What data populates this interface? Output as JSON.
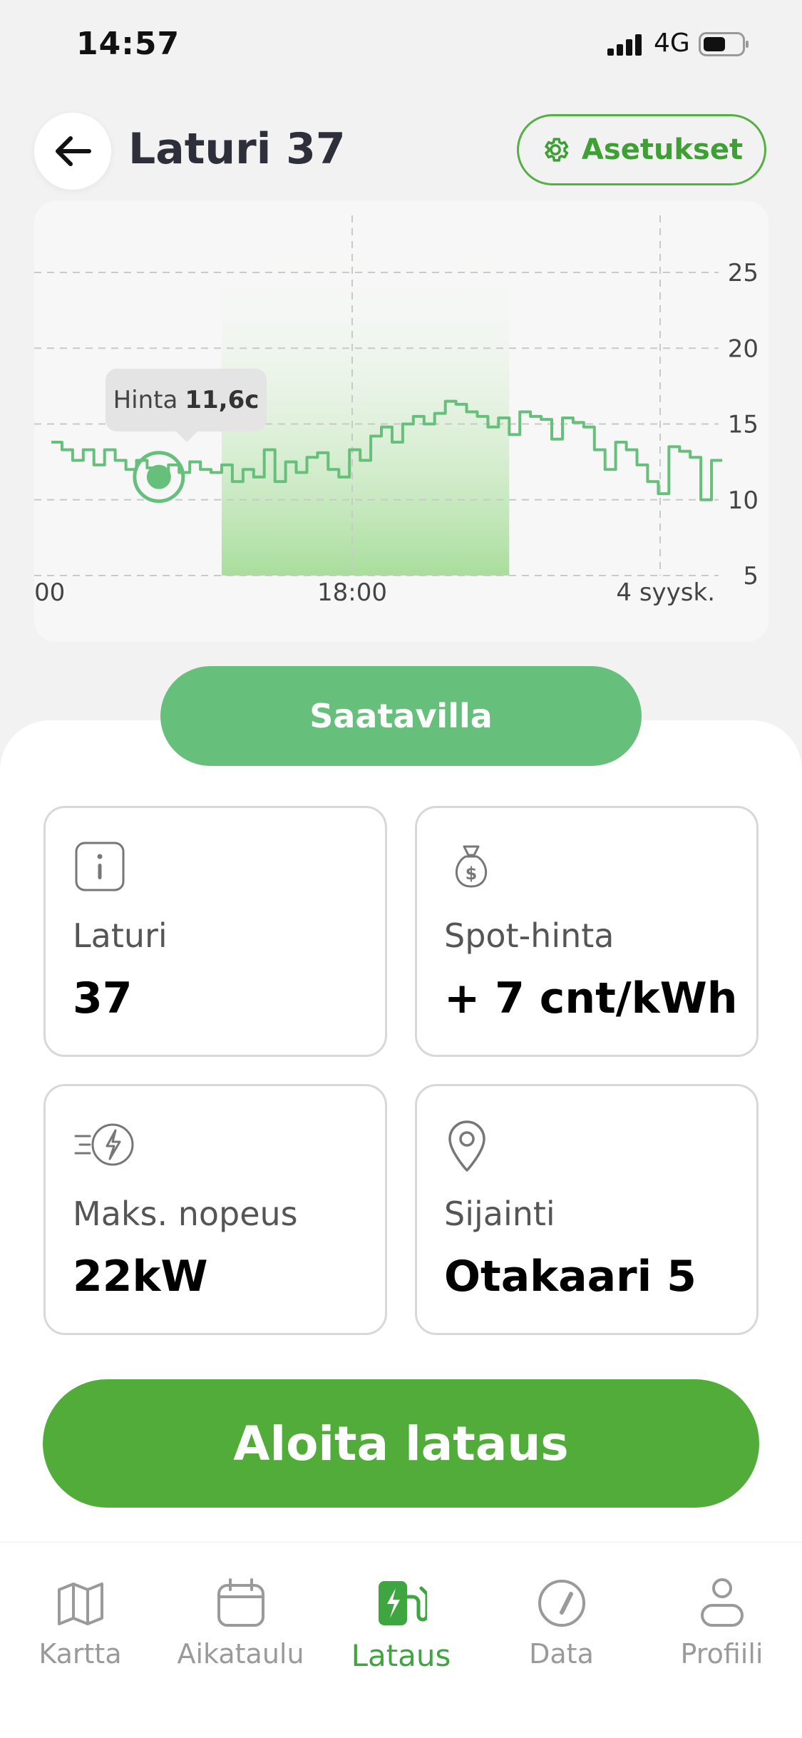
{
  "status_bar": {
    "time": "14:57",
    "network": "4G"
  },
  "header": {
    "title": "Laturi 37",
    "settings_label": "Asetukset"
  },
  "chart_data": {
    "type": "line",
    "x_tick_labels": [
      "00",
      "18:00",
      "4 syysk."
    ],
    "y_ticks": [
      25,
      20,
      15,
      10,
      5
    ],
    "ylim": [
      5,
      27
    ],
    "grid": true,
    "series": [
      {
        "values": [
          13.8,
          13.3,
          12.6,
          13.3,
          12.3,
          13.3,
          12.6,
          12.0,
          12.6,
          12.1,
          11.6,
          12.3,
          11.8,
          12.5,
          12.0,
          11.8,
          12.3,
          11.2,
          12.0,
          11.5,
          13.3,
          11.2,
          12.5,
          11.8,
          12.8,
          13.1,
          12.0,
          11.5,
          13.3,
          12.6,
          14.2,
          14.8,
          13.8,
          15.0,
          15.5,
          15.0,
          15.7,
          16.5,
          16.3,
          15.8,
          15.5,
          14.8,
          15.4,
          14.3,
          15.8,
          15.5,
          15.3,
          14.0,
          15.4,
          15.1,
          14.8,
          13.3,
          12.0,
          13.8,
          13.3,
          12.3,
          11.2,
          10.4,
          13.5,
          13.2,
          12.8,
          10.0,
          12.6
        ]
      }
    ],
    "highlight_range": [
      16,
      43
    ],
    "tooltip": {
      "label": "Hinta",
      "value": "11,6c",
      "index": 10
    }
  },
  "status_pill": "Saatavilla",
  "cards": [
    {
      "icon": "info-icon",
      "label": "Laturi",
      "value": "37"
    },
    {
      "icon": "money-bag-icon",
      "label": "Spot-hinta",
      "value": "+ 7 cnt/kWh"
    },
    {
      "icon": "fast-charge-icon",
      "label": "Maks. nopeus",
      "value": "22kW"
    },
    {
      "icon": "location-pin-icon",
      "label": "Sijainti",
      "value": "Otakaari 5"
    }
  ],
  "start_button": "Aloita lataus",
  "tabs": [
    {
      "icon": "map-icon",
      "label": "Kartta"
    },
    {
      "icon": "calendar-icon",
      "label": "Aikataulu"
    },
    {
      "icon": "charging-station-icon",
      "label": "Lataus",
      "active": true
    },
    {
      "icon": "gauge-icon",
      "label": "Data"
    },
    {
      "icon": "user-icon",
      "label": "Profiili"
    }
  ],
  "colors": {
    "accent": "#52ac3a",
    "pill": "#66bf7a",
    "line": "#66bf7a",
    "highlight": "#9bd98c"
  }
}
